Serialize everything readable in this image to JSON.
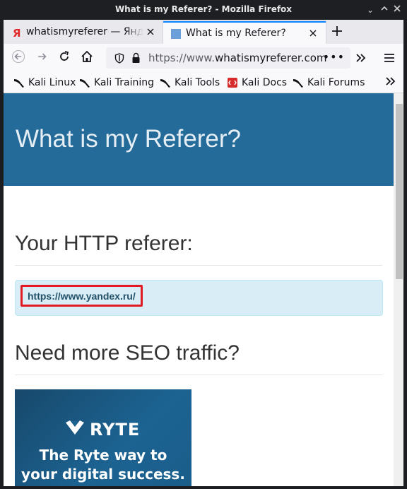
{
  "window": {
    "title": "What is my Referer? - Mozilla Firefox"
  },
  "tabs": [
    {
      "label": "whatismyreferer — Яндекс",
      "icon": "yandex-favicon",
      "active": false
    },
    {
      "label": "What is my Referer?",
      "icon": "page-favicon",
      "active": true
    }
  ],
  "navbar": {
    "url_prefix": "https://www.",
    "url_domain": "whatismyreferer.com",
    "icons": [
      "back-arrow-icon",
      "forward-arrow-icon",
      "reload-icon",
      "home-icon",
      "shield-icon",
      "lock-icon",
      "more-dots-icon",
      "overflow-chevrons-icon",
      "hamburger-menu-icon"
    ]
  },
  "bookmarks": [
    {
      "label": "Kali Linux",
      "icon": "kali-dragon-icon"
    },
    {
      "label": "Kali Training",
      "icon": "kali-dragon-icon"
    },
    {
      "label": "Kali Tools",
      "icon": "kali-dragon-icon"
    },
    {
      "label": "Kali Docs",
      "icon": "kali-docs-icon"
    },
    {
      "label": "Kali Forums",
      "icon": "kali-dragon-icon"
    }
  ],
  "page": {
    "hero_title": "What is my Referer?",
    "referer_heading": "Your HTTP referer:",
    "referer_value": "https://www.yandex.ru/",
    "seo_heading": "Need more SEO traffic?",
    "ad": {
      "brand": "RYTE",
      "tagline_1": "The Ryte way to",
      "tagline_2": "your digital success."
    }
  },
  "colors": {
    "hero_bg": "#246b99",
    "referer_box_bg": "#d9edf7",
    "highlight_border": "#e01b24",
    "active_tab_accent": "#0a84ff"
  }
}
